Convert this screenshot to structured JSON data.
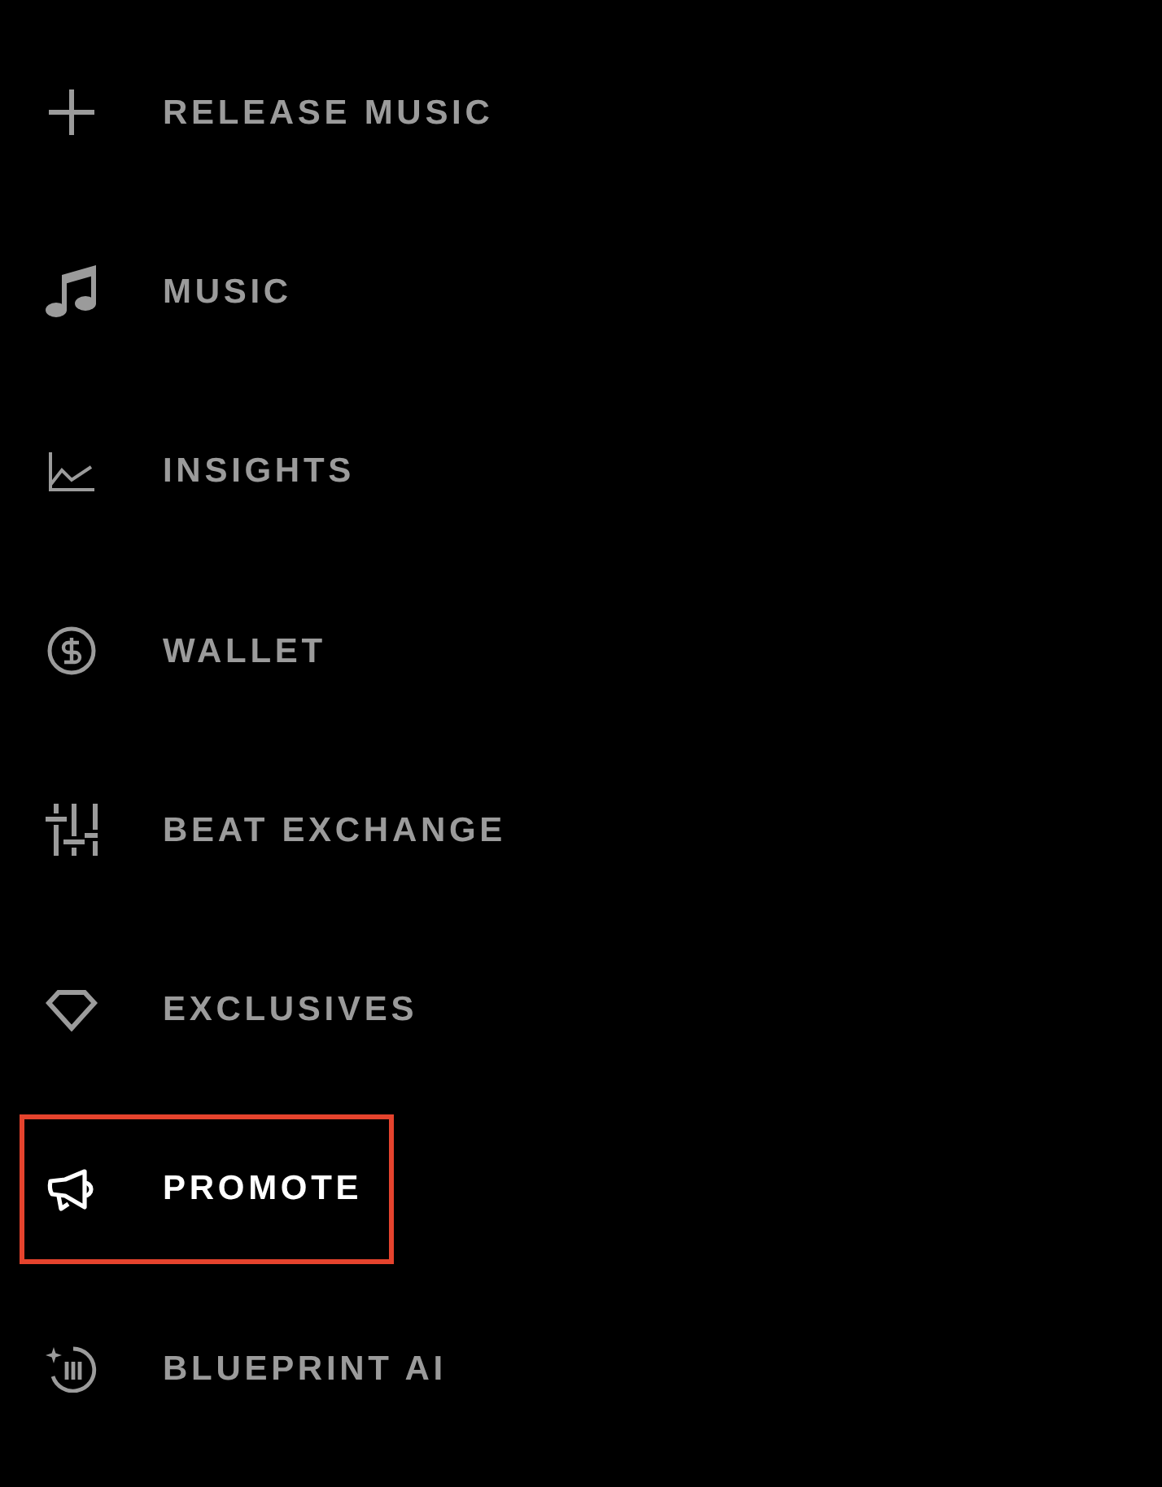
{
  "nav": {
    "items": [
      {
        "label": "RELEASE MUSIC",
        "selected": false,
        "highlighted": false
      },
      {
        "label": "MUSIC",
        "selected": false,
        "highlighted": false
      },
      {
        "label": "INSIGHTS",
        "selected": false,
        "highlighted": false
      },
      {
        "label": "WALLET",
        "selected": false,
        "highlighted": false
      },
      {
        "label": "BEAT EXCHANGE",
        "selected": false,
        "highlighted": false
      },
      {
        "label": "EXCLUSIVES",
        "selected": false,
        "highlighted": false
      },
      {
        "label": "PROMOTE",
        "selected": true,
        "highlighted": true
      },
      {
        "label": "BLUEPRINT AI",
        "selected": false,
        "highlighted": false
      }
    ]
  }
}
